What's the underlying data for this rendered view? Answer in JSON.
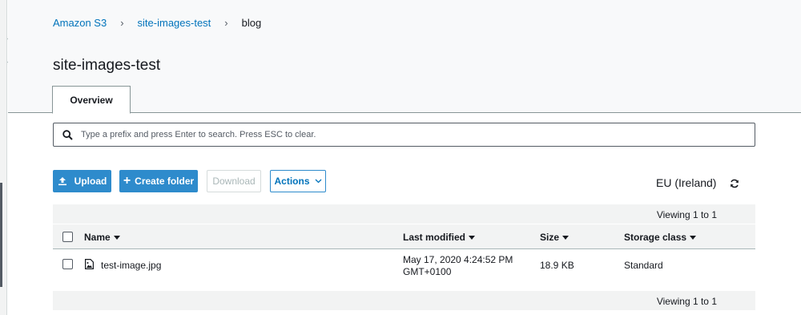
{
  "breadcrumb": {
    "items": [
      "Amazon S3",
      "site-images-test",
      "blog"
    ]
  },
  "page_title": "site-images-test",
  "tabs": [
    {
      "label": "Overview"
    }
  ],
  "search": {
    "placeholder": "Type a prefix and press Enter to search. Press ESC to clear.",
    "value": ""
  },
  "toolbar": {
    "upload_label": "Upload",
    "create_folder_label": "Create folder",
    "download_label": "Download",
    "actions_label": "Actions"
  },
  "region": "EU (Ireland)",
  "viewing_text": "Viewing 1 to 1",
  "table": {
    "columns": [
      "Name",
      "Last modified",
      "Size",
      "Storage class"
    ],
    "rows": [
      {
        "name": "test-image.jpg",
        "last_modified_line1": "May 17, 2020 4:24:52 PM",
        "last_modified_line2": "GMT+0100",
        "size": "18.9 KB",
        "storage_class": "Standard"
      }
    ]
  },
  "colors": {
    "accent": "#2e8bcc",
    "link": "#0073bb",
    "header_bg": "#f8f9fa",
    "table_bg": "#f2f3f3"
  },
  "icons": [
    "chevron-right-icon",
    "search-icon",
    "upload-icon",
    "plus-icon",
    "chevron-down-icon",
    "refresh-icon",
    "image-file-icon",
    "caret-down-icon"
  ]
}
